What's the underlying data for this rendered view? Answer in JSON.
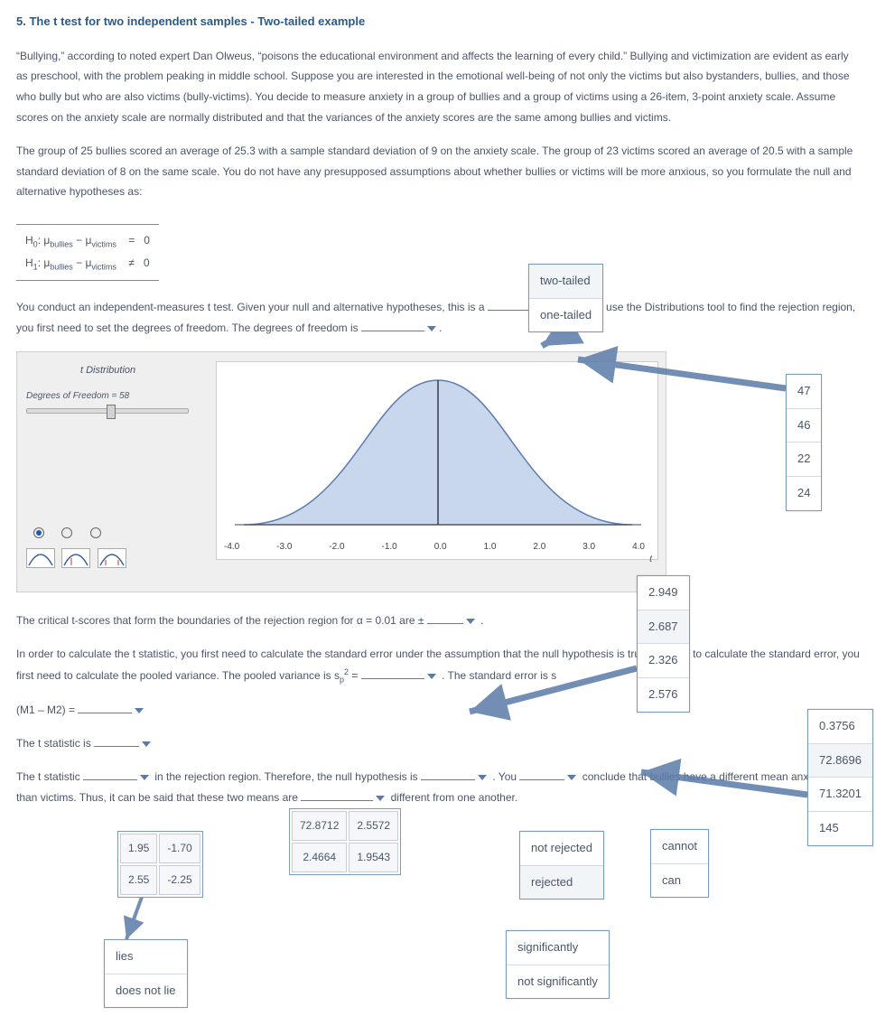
{
  "title": "5. The t test for two independent samples - Two-tailed example",
  "para1": "“Bullying,” according to noted expert Dan Olweus, “poisons the educational environment and affects the learning of every child.” Bullying and victimization are evident as early as preschool, with the problem peaking in middle school. Suppose you are interested in the emotional well-being of not only the victims but also bystanders, bullies, and those who bully but who are also victims (bully-victims). You decide to measure anxiety in a group of bullies and a group of victims using a 26-item, 3-point anxiety scale. Assume scores on the anxiety scale are normally distributed and that the variances of the anxiety scores are the same among bullies and victims.",
  "para2": "The group of 25 bullies scored an average of 25.3 with a sample standard deviation of 9 on the anxiety scale. The group of 23 victims scored an average of 20.5 with a sample standard deviation of 8 on the same scale. You do not have any presupposed assumptions about whether bullies or victims will be more anxious, so you formulate the null and alternative hypotheses as:",
  "hyp": {
    "h0_left": "H",
    "h0_sub": "0",
    "h0_expr": ": μ",
    "h0_s1": "bullies",
    "h0_minus": " − μ",
    "h0_s2": "victims",
    "h0_eq": "=",
    "h0_v": "0",
    "h1_left": "H",
    "h1_sub": "1",
    "h1_expr": ": μ",
    "h1_s1": "bullies",
    "h1_minus": " − μ",
    "h1_s2": "victims",
    "h1_ne": "≠",
    "h1_v": "0"
  },
  "tail_opts": [
    "two-tailed",
    "one-tailed"
  ],
  "para3a": "You conduct an independent-measures t test. Given your null and alternative hypotheses, this is a ",
  "para3b": " test. To use the Distributions tool to find the rejection region, you first need to set the degrees of freedom. The degrees of freedom is ",
  "df_opts": [
    "47",
    "46",
    "22",
    "24"
  ],
  "tool": {
    "hdr": "t Distribution",
    "df_label": "Degrees of Freedom = 58",
    "ticks": [
      "-4.0",
      "-3.0",
      "-2.0",
      "-1.0",
      "0.0",
      "1.0",
      "2.0",
      "3.0",
      "4.0"
    ],
    "tlabel": "t"
  },
  "critical_opts": [
    "2.949",
    "2.687",
    "2.326",
    "2.576"
  ],
  "para4": "The critical t-scores that form the boundaries of the rejection region for α = 0.01 are ± ",
  "para5a": "In order to calculate the t statistic, you first need to calculate the standard error under the assumption that the null hypothesis is true. In order to calculate the standard error, you first need to calculate the pooled variance. The pooled variance is s",
  "para5b": " = ",
  "para5c": " . The standard error is s",
  "se_opts": [
    "0.3756",
    "72.8696",
    "71.3201",
    "145"
  ],
  "m1m2": "(M1 – M2) = ",
  "pooled_tbl": [
    [
      "72.8712",
      "2.5572"
    ],
    [
      "2.4664",
      "1.9543"
    ]
  ],
  "tstat_label": "The t statistic is ",
  "tstat_tbl": [
    [
      "1.95",
      "-1.70"
    ],
    [
      "2.55",
      "-2.25"
    ]
  ],
  "para6a": "The t statistic ",
  "para6b": " in the rejection region. Therefore, the null hypothesis is ",
  "para6c": " . You ",
  "para6d": " conclude that bullies have a different mean anxiety score than victims. Thus, it can be said that these two means are ",
  "para6e": " different from one another.",
  "reject_opts": [
    "not rejected",
    "rejected"
  ],
  "can_opts": [
    "cannot",
    "can"
  ],
  "lie_opts": [
    "lies",
    "does not lie"
  ],
  "sig_opts": [
    "significantly",
    "not significantly"
  ]
}
